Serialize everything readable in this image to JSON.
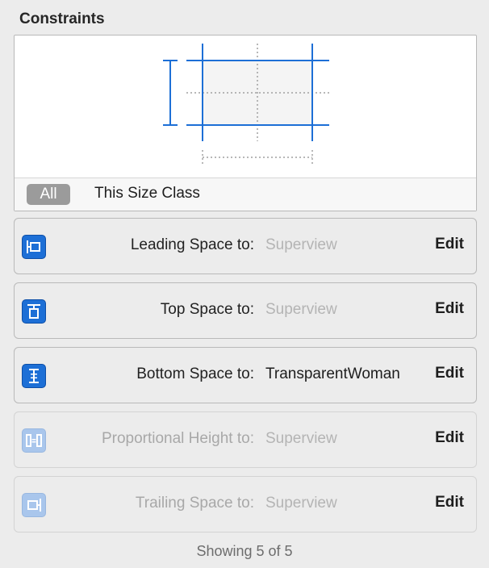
{
  "panel": {
    "title": "Constraints"
  },
  "editor": {
    "filter_all_label": "All",
    "size_class_label": "This Size Class"
  },
  "constraints": [
    {
      "label": "Leading Space to:",
      "value": "Superview",
      "edit_label": "Edit",
      "icon": "leading-space-icon",
      "state": "enabled"
    },
    {
      "label": "Top Space to:",
      "value": "Superview",
      "edit_label": "Edit",
      "icon": "top-space-icon",
      "state": "enabled"
    },
    {
      "label": "Bottom Space to:",
      "value": "TransparentWoman",
      "edit_label": "Edit",
      "icon": "bottom-space-icon",
      "state": "enabled"
    },
    {
      "label": "Proportional Height to:",
      "value": "Superview",
      "edit_label": "Edit",
      "icon": "proportional-height-icon",
      "state": "disabled"
    },
    {
      "label": "Trailing Space to:",
      "value": "Superview",
      "edit_label": "Edit",
      "icon": "trailing-space-icon",
      "state": "disabled"
    }
  ],
  "footer": {
    "showing_text": "Showing 5 of 5"
  },
  "colors": {
    "accent": "#1d6fd6",
    "accent_faded": "#a9c6ec",
    "panel_bg": "#ececec"
  }
}
